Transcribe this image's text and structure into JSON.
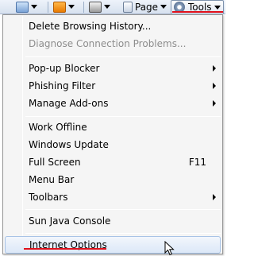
{
  "toolbar": {
    "page_label": "Page",
    "tools_label": "Tools"
  },
  "menu": {
    "items": [
      {
        "label": "Delete Browsing History..."
      },
      {
        "label": "Diagnose Connection Problems..."
      },
      {
        "label": "Pop-up Blocker"
      },
      {
        "label": "Phishing Filter"
      },
      {
        "label": "Manage Add-ons"
      },
      {
        "label": "Work Offline"
      },
      {
        "label": "Windows Update"
      },
      {
        "label": "Full Screen",
        "shortcut": "F11"
      },
      {
        "label": "Menu Bar"
      },
      {
        "label": "Toolbars"
      },
      {
        "label": "Sun Java Console"
      },
      {
        "label": "Internet Options"
      }
    ]
  },
  "colors": {
    "highlight_annotation": "#e0101b",
    "disabled_text": "#8d8d8d",
    "menu_bg": "#f5f5f5"
  }
}
